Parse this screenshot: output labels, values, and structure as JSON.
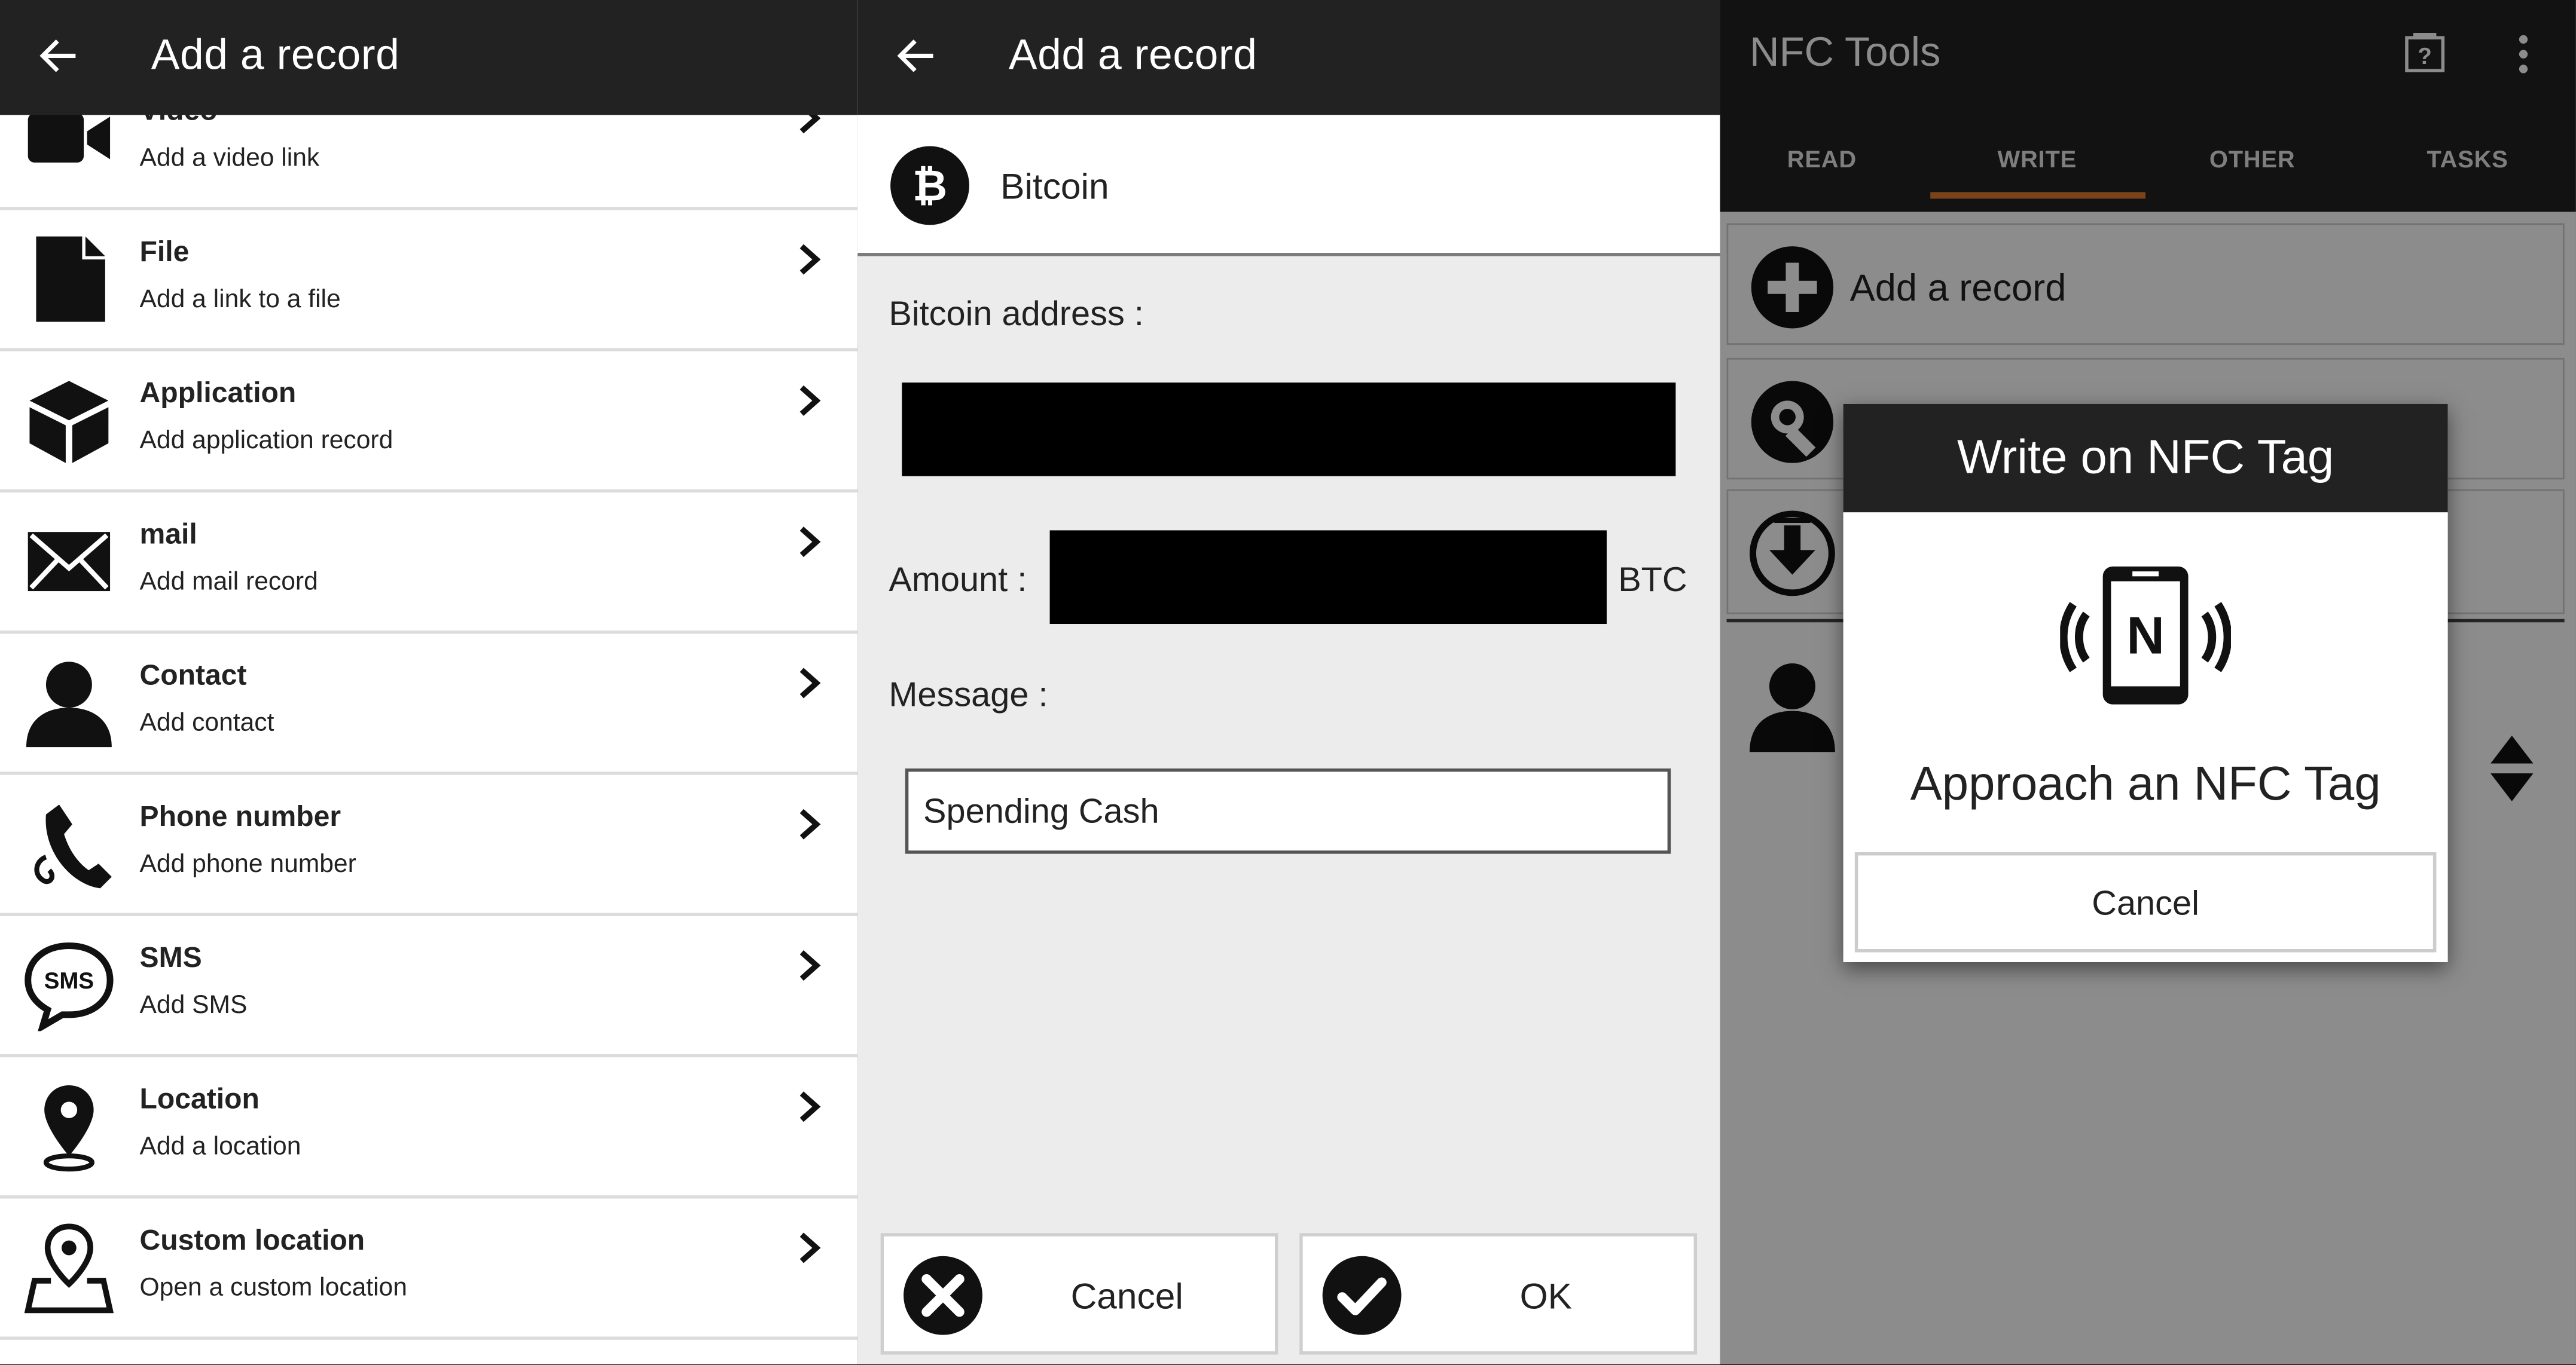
{
  "panel_left": {
    "header": {
      "title": "Add a record",
      "back_icon": "arrow-left-icon"
    },
    "items": [
      {
        "title": "Video",
        "subtitle": "Add a video link",
        "icon": "video-camera-icon"
      },
      {
        "title": "File",
        "subtitle": "Add a link to a file",
        "icon": "file-icon"
      },
      {
        "title": "Application",
        "subtitle": "Add application record",
        "icon": "cube-icon"
      },
      {
        "title": "mail",
        "subtitle": "Add mail record",
        "icon": "envelope-icon"
      },
      {
        "title": "Contact",
        "subtitle": "Add contact",
        "icon": "person-icon"
      },
      {
        "title": "Phone number",
        "subtitle": "Add phone number",
        "icon": "phone-icon"
      },
      {
        "title": "SMS",
        "subtitle": "Add SMS",
        "icon": "sms-bubble-icon"
      },
      {
        "title": "Location",
        "subtitle": "Add a location",
        "icon": "map-pin-icon"
      },
      {
        "title": "Custom location",
        "subtitle": "Open a custom location",
        "icon": "custom-map-pin-icon"
      }
    ]
  },
  "panel_middle": {
    "header": {
      "title": "Add a record",
      "back_icon": "arrow-left-icon"
    },
    "record_type": {
      "label": "Bitcoin",
      "icon": "bitcoin-icon"
    },
    "form": {
      "address_label": "Bitcoin address :",
      "amount_label": "Amount :",
      "amount_unit": "BTC",
      "message_label": "Message :",
      "message_value": "Spending Cash"
    },
    "buttons": {
      "cancel": "Cancel",
      "ok": "OK"
    }
  },
  "panel_right": {
    "app_title": "NFC Tools",
    "tabs": [
      {
        "label": "READ",
        "active": false
      },
      {
        "label": "WRITE",
        "active": true
      },
      {
        "label": "OTHER",
        "active": false
      },
      {
        "label": "TASKS",
        "active": false
      }
    ],
    "add_record_label": "Add a record",
    "accent_color": "#e07a2e",
    "dialog": {
      "title": "Write on NFC Tag",
      "message": "Approach an NFC Tag",
      "cancel": "Cancel",
      "icon": "nfc-phone-icon",
      "nfc_letter": "N"
    }
  }
}
